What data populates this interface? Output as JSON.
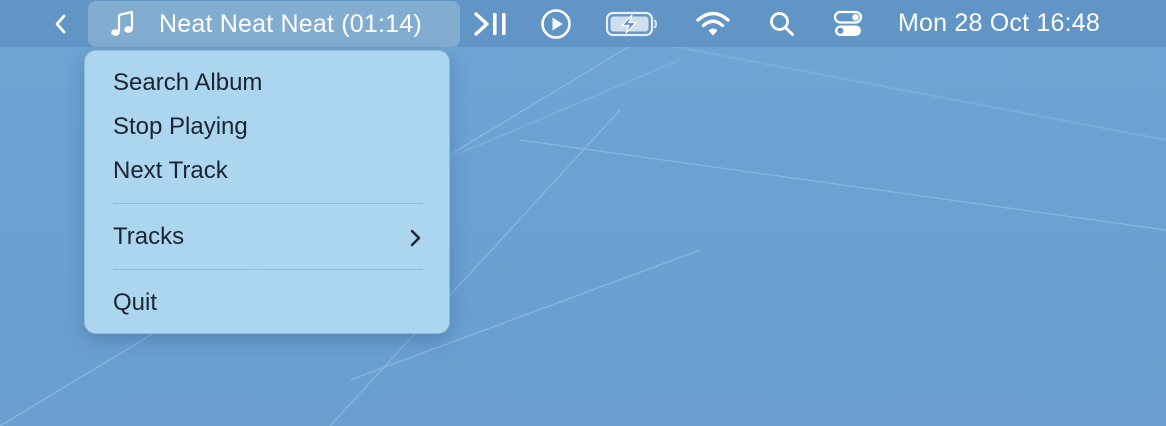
{
  "menubar": {
    "now_playing": {
      "title": "Neat Neat Neat (01:14)",
      "icon": "music-note-icon"
    },
    "icons": [
      "chevron-left-icon",
      "skip-play-pause-icon",
      "play-circle-icon",
      "battery-charging-icon",
      "wifi-icon",
      "search-icon",
      "control-center-icon"
    ],
    "clock": "Mon 28 Oct  16:48"
  },
  "menu": {
    "items": [
      {
        "label": "Search Album"
      },
      {
        "label": "Stop Playing"
      },
      {
        "label": "Next Track"
      },
      {
        "label": "Tracks",
        "has_submenu": true
      },
      {
        "label": "Quit"
      }
    ]
  },
  "colors": {
    "desktop": "#6aa2d2",
    "menubar": "#6094c4",
    "menu_background": "#aed7f0",
    "menu_text": "#1b2430"
  }
}
